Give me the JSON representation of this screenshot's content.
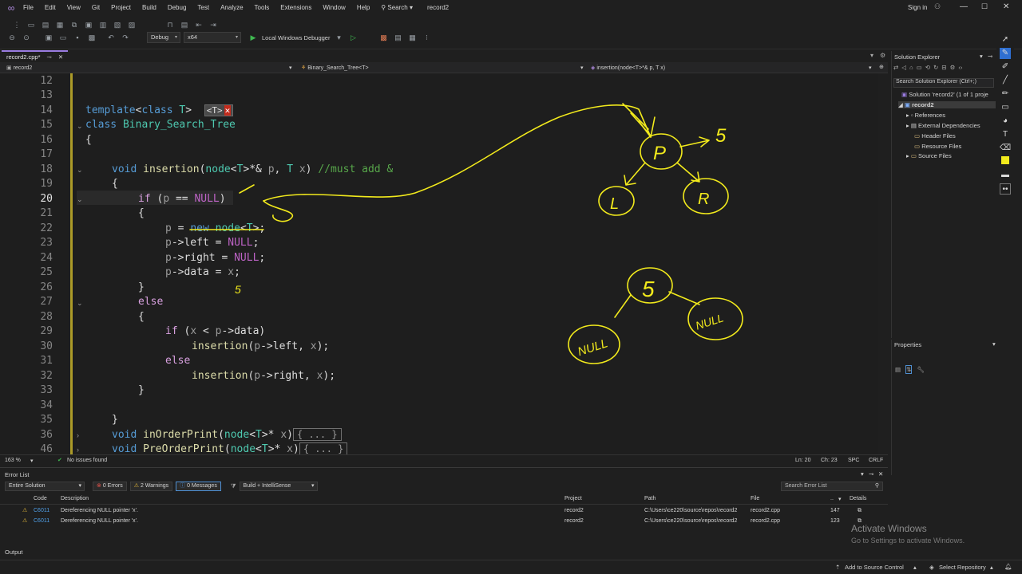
{
  "menu": {
    "items": [
      "File",
      "Edit",
      "View",
      "Git",
      "Project",
      "Build",
      "Debug",
      "Test",
      "Analyze",
      "Tools",
      "Extensions",
      "Window",
      "Help"
    ],
    "search_label": "Search",
    "solution_name": "record2",
    "sign_in": "Sign in"
  },
  "toolbar": {
    "config": "Debug",
    "platform": "x64",
    "debugger_label": "Local Windows Debugger"
  },
  "tabs": {
    "active_tab": "record2.cpp*"
  },
  "navbar": {
    "project": "record2",
    "class_scope": "Binary_Search_Tree<T>",
    "member_scope": "insertion(node<T>*& p, T x)"
  },
  "editor": {
    "line_numbers": [
      "12",
      "13",
      "14",
      "15",
      "16",
      "17",
      "18",
      "19",
      "20",
      "21",
      "22",
      "23",
      "24",
      "25",
      "26",
      "27",
      "28",
      "29",
      "30",
      "31",
      "32",
      "33",
      "34",
      "35",
      "36",
      "46"
    ],
    "current_line": "20",
    "template_hint": "<T>"
  },
  "editor_status": {
    "zoom": "163 %",
    "issues": "No issues found",
    "line": "Ln: 20",
    "col": "Ch: 23",
    "spc": "SPC",
    "crlf": "CRLF"
  },
  "error_list": {
    "title": "Error List",
    "scope": "Entire Solution",
    "errors": "0 Errors",
    "warnings": "2 Warnings",
    "messages": "0 Messages",
    "build_filter": "Build + IntelliSense",
    "search_placeholder": "Search Error List",
    "columns": [
      "Code",
      "Description",
      "Project",
      "Path",
      "File",
      "..",
      "Details"
    ],
    "rows": [
      {
        "code": "C6011",
        "description": "Dereferencing NULL pointer 'x'.",
        "project": "record2",
        "path": "C:\\Users\\ce220\\source\\repos\\record2",
        "file": "record2.cpp",
        "line": "147"
      },
      {
        "code": "C6011",
        "description": "Dereferencing NULL pointer 'x'.",
        "project": "record2",
        "path": "C:\\Users\\ce220\\source\\repos\\record2",
        "file": "record2.cpp",
        "line": "123"
      }
    ]
  },
  "output_tab": "Output",
  "bottom_bar": {
    "source_control": "Add to Source Control",
    "repository": "Select Repository"
  },
  "solution_explorer": {
    "title": "Solution Explorer",
    "search_placeholder": "Search Solution Explorer (Ctrl+;)",
    "solution_label": "Solution 'record2' (1 of 1 proje",
    "project": "record2",
    "items": [
      "References",
      "External Dependencies",
      "Header Files",
      "Resource Files",
      "Source Files"
    ]
  },
  "properties": {
    "title": "Properties"
  },
  "watermark": {
    "line1": "Activate Windows",
    "line2": "Go to Settings to activate Windows."
  },
  "annotations": {
    "colors": {
      "ink": "#f2ea1c"
    },
    "labels": [
      "P",
      "L",
      "R",
      "5",
      "5",
      "5",
      "NULL",
      "NULL"
    ]
  }
}
